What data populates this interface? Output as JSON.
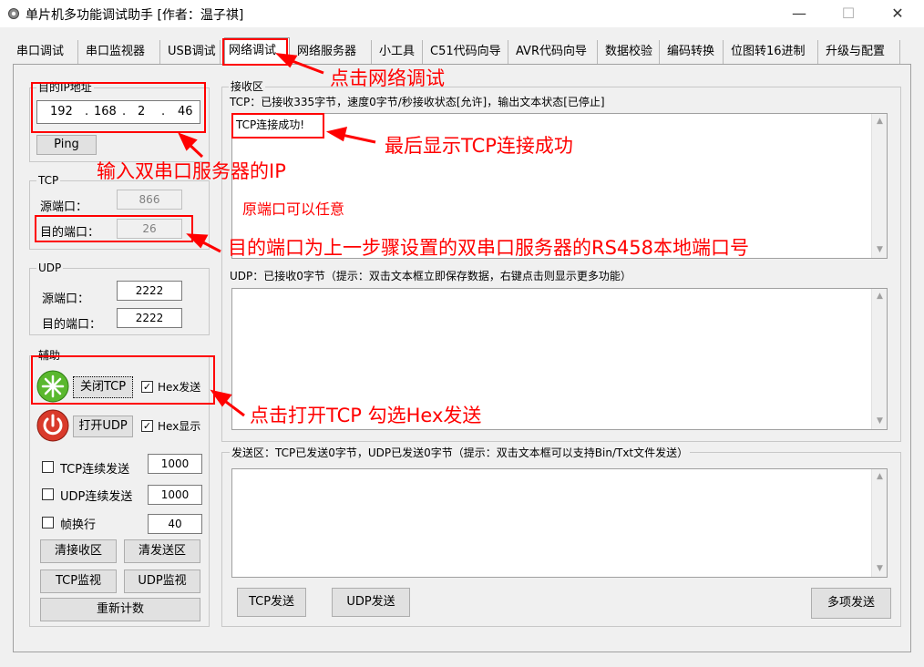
{
  "window": {
    "title": "单片机多功能调试助手 [作者：温子祺]",
    "minimize": "—",
    "maximize": "☐",
    "close": "✕"
  },
  "tabs": [
    "串口调试",
    "串口监视器",
    "USB调试",
    "网络调试",
    "网络服务器",
    "小工具",
    "C51代码向导",
    "AVR代码向导",
    "数据校验",
    "编码转换",
    "位图转16进制",
    "升级与配置"
  ],
  "ip_group": {
    "label": "目的IP地址",
    "octets": [
      "192",
      "168",
      "2",
      "46"
    ],
    "dot": ".",
    "ping": "Ping"
  },
  "tcp_group": {
    "label": "TCP",
    "src_port_label": "源端口：",
    "src_port": "866",
    "dst_port_label": "目的端口：",
    "dst_port": "26"
  },
  "udp_group": {
    "label": "UDP",
    "src_port_label": "源端口：",
    "src_port": "2222",
    "dst_port_label": "目的端口：",
    "dst_port": "2222"
  },
  "aux_group": {
    "label": "辅助",
    "close_tcp": "关闭TCP",
    "hex_send": "Hex发送",
    "open_udp": "打开UDP",
    "hex_show": "Hex显示",
    "tcp_loop": "TCP连续发送",
    "tcp_loop_val": "1000",
    "udp_loop": "UDP连续发送",
    "udp_loop_val": "1000",
    "frame_break": "帧换行",
    "frame_break_val": "40",
    "clear_recv": "清接收区",
    "clear_send": "清发送区",
    "tcp_monitor": "TCP监视",
    "udp_monitor": "UDP监视",
    "recount": "重新计数",
    "check": "✓"
  },
  "recv_group": {
    "label": "接收区",
    "tcp_status": "TCP：已接收335字节，速度0字节/秒接收状态[允许]，输出文本状态[已停止]",
    "tcp_text": "TCP连接成功!",
    "udp_status": "UDP：已接收0字节（提示：双击文本框立即保存数据，右键点击则显示更多功能）"
  },
  "send_group": {
    "status": "发送区：TCP已发送0字节，UDP已发送0字节（提示：双击文本框可以支持Bin/Txt文件发送）",
    "tcp_send": "TCP发送",
    "udp_send": "UDP发送",
    "multi_send": "多项发送"
  },
  "annotations": {
    "click_net": "点击网络调试",
    "input_ip": "输入双串口服务器的IP",
    "tcp_ok": "最后显示TCP连接成功",
    "src_any": "原端口可以任意",
    "dst_port": "目的端口为上一步骤设置的双串口服务器的RS458本地端口号",
    "open_tcp": "点击打开TCP 勾选Hex发送"
  },
  "colors": {
    "annotation": "#ff0000",
    "window_bg": "#f0f0f0",
    "green_icon": "#5ab82e",
    "red_icon": "#d93a2b"
  },
  "icons": {
    "app": "settings-gear-icon",
    "tcp_status": "green-connected-icon",
    "udp_status": "red-power-icon"
  }
}
